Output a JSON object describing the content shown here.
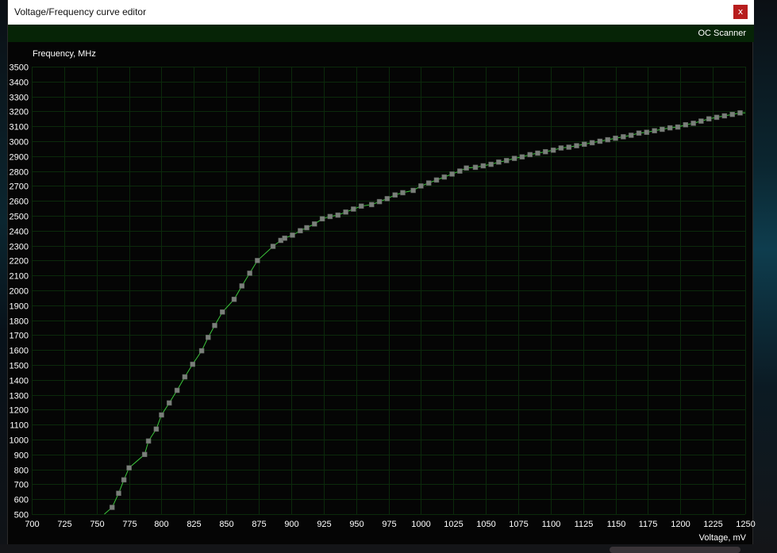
{
  "window": {
    "title": "Voltage/Frequency curve editor",
    "close_label": "x"
  },
  "toolbar": {
    "oc_scanner_label": "OC Scanner",
    "background_color": "#062406"
  },
  "colors": {
    "grid": "#0b2a0b",
    "curve": "#3cc83c",
    "point": "#7a7f7a",
    "plot_background": "#050505"
  },
  "chart_data": {
    "type": "line",
    "title": "",
    "xlabel": "Voltage, mV",
    "ylabel": "Frequency, MHz",
    "xlim": [
      700,
      1250
    ],
    "ylim": [
      500,
      3500
    ],
    "x_ticks": [
      700,
      725,
      750,
      775,
      800,
      825,
      850,
      875,
      900,
      925,
      950,
      975,
      1000,
      1025,
      1050,
      1075,
      1100,
      1125,
      1150,
      1175,
      1200,
      1225,
      1250
    ],
    "y_ticks": [
      500,
      600,
      700,
      800,
      900,
      1000,
      1100,
      1200,
      1300,
      1400,
      1500,
      1600,
      1700,
      1800,
      1900,
      2000,
      2100,
      2200,
      2300,
      2400,
      2500,
      2600,
      2700,
      2800,
      2900,
      3000,
      3100,
      3200,
      3300,
      3400,
      3500
    ],
    "grid": true,
    "curve_extends_to": [
      [
        756,
        500
      ],
      [
        1250,
        3190
      ]
    ],
    "series": [
      {
        "points": [
          [
            762,
            545
          ],
          [
            767,
            640
          ],
          [
            771,
            730
          ],
          [
            775,
            810
          ],
          [
            787,
            900
          ],
          [
            790,
            990
          ],
          [
            796,
            1070
          ],
          [
            800,
            1165
          ],
          [
            806,
            1245
          ],
          [
            812,
            1330
          ],
          [
            818,
            1420
          ],
          [
            824,
            1505
          ],
          [
            831,
            1595
          ],
          [
            836,
            1685
          ],
          [
            841,
            1765
          ],
          [
            847,
            1855
          ],
          [
            856,
            1940
          ],
          [
            862,
            2030
          ],
          [
            868,
            2115
          ],
          [
            874,
            2200
          ],
          [
            886,
            2295
          ],
          [
            892,
            2335
          ],
          [
            895,
            2350
          ],
          [
            901,
            2370
          ],
          [
            907,
            2400
          ],
          [
            912,
            2420
          ],
          [
            918,
            2445
          ],
          [
            924,
            2480
          ],
          [
            930,
            2495
          ],
          [
            936,
            2505
          ],
          [
            942,
            2525
          ],
          [
            948,
            2545
          ],
          [
            954,
            2565
          ],
          [
            962,
            2575
          ],
          [
            968,
            2595
          ],
          [
            974,
            2615
          ],
          [
            980,
            2640
          ],
          [
            986,
            2655
          ],
          [
            994,
            2670
          ],
          [
            1000,
            2700
          ],
          [
            1006,
            2720
          ],
          [
            1012,
            2740
          ],
          [
            1018,
            2760
          ],
          [
            1024,
            2780
          ],
          [
            1030,
            2800
          ],
          [
            1035,
            2820
          ],
          [
            1042,
            2825
          ],
          [
            1048,
            2835
          ],
          [
            1054,
            2845
          ],
          [
            1060,
            2860
          ],
          [
            1066,
            2870
          ],
          [
            1072,
            2885
          ],
          [
            1078,
            2895
          ],
          [
            1084,
            2910
          ],
          [
            1090,
            2920
          ],
          [
            1096,
            2930
          ],
          [
            1102,
            2940
          ],
          [
            1108,
            2955
          ],
          [
            1114,
            2960
          ],
          [
            1120,
            2970
          ],
          [
            1126,
            2980
          ],
          [
            1132,
            2990
          ],
          [
            1138,
            3000
          ],
          [
            1144,
            3010
          ],
          [
            1150,
            3020
          ],
          [
            1156,
            3030
          ],
          [
            1162,
            3040
          ],
          [
            1168,
            3055
          ],
          [
            1174,
            3060
          ],
          [
            1180,
            3070
          ],
          [
            1186,
            3080
          ],
          [
            1192,
            3090
          ],
          [
            1198,
            3095
          ],
          [
            1204,
            3110
          ],
          [
            1210,
            3120
          ],
          [
            1216,
            3135
          ],
          [
            1222,
            3150
          ],
          [
            1228,
            3160
          ],
          [
            1234,
            3170
          ],
          [
            1240,
            3180
          ],
          [
            1246,
            3190
          ],
          [
            1252,
            3190
          ]
        ]
      }
    ]
  }
}
